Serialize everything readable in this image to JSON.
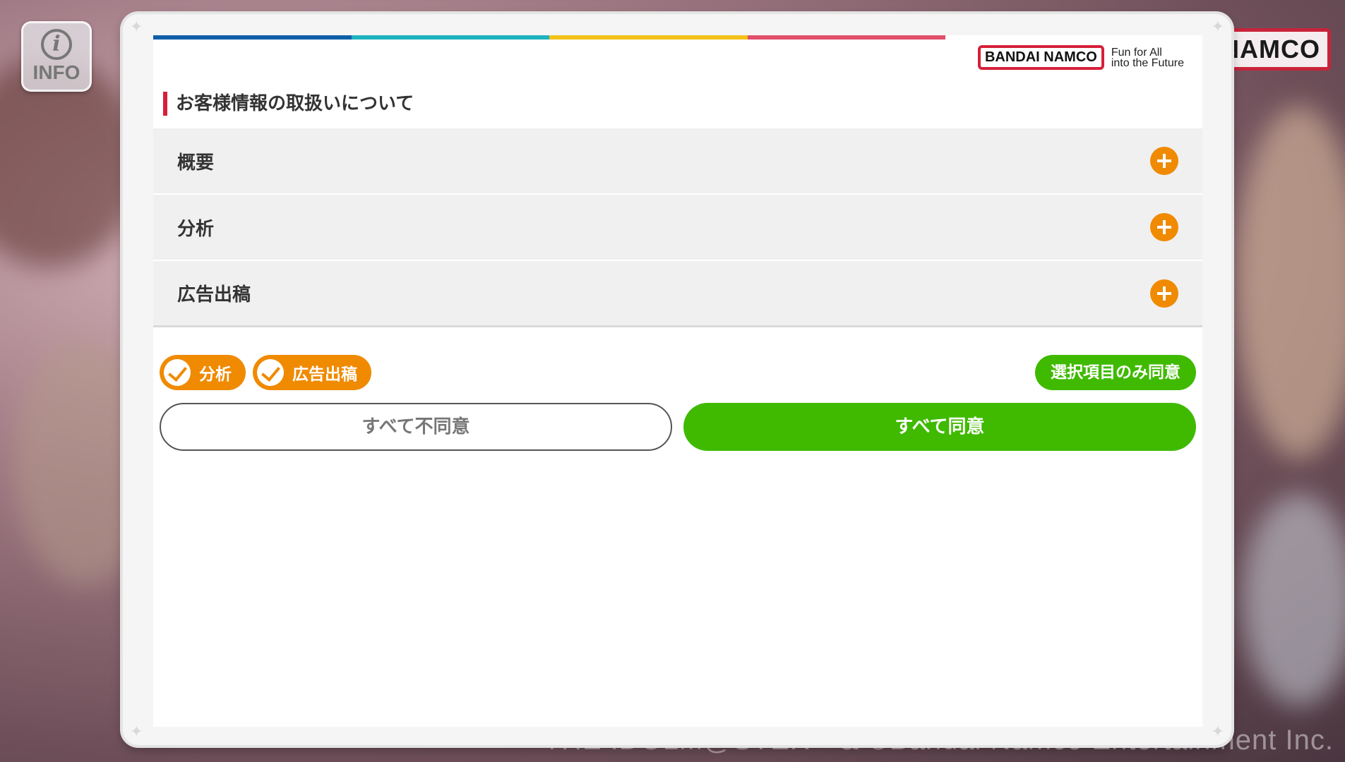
{
  "info_button": {
    "label": "INFO",
    "glyph": "i"
  },
  "background": {
    "logo_text": "NAMCO",
    "copyright": "THE IDOLM@STER™& ©Bandai Namco Entertainment Inc."
  },
  "brand": {
    "logo_text": "BANDAI NAMCO",
    "tagline_line1": "Fun for All",
    "tagline_line2": "into the Future",
    "stripe_colors": [
      "#0f5fa8",
      "#1fb2c0",
      "#f3c21a",
      "#e0506a"
    ]
  },
  "consent": {
    "title": "お客様情報の取扱いについて",
    "sections": [
      {
        "label": "概要",
        "icon": "plus-icon"
      },
      {
        "label": "分析",
        "icon": "plus-icon"
      },
      {
        "label": "広告出稿",
        "icon": "plus-icon"
      }
    ],
    "chips": [
      {
        "label": "分析",
        "checked": true
      },
      {
        "label": "広告出稿",
        "checked": true
      }
    ],
    "select_agree_label": "選択項目のみ同意",
    "disagree_all_label": "すべて不同意",
    "agree_all_label": "すべて同意"
  },
  "colors": {
    "accent_orange": "#f08a00",
    "accent_green": "#3fba00",
    "brand_red": "#d6203a"
  }
}
